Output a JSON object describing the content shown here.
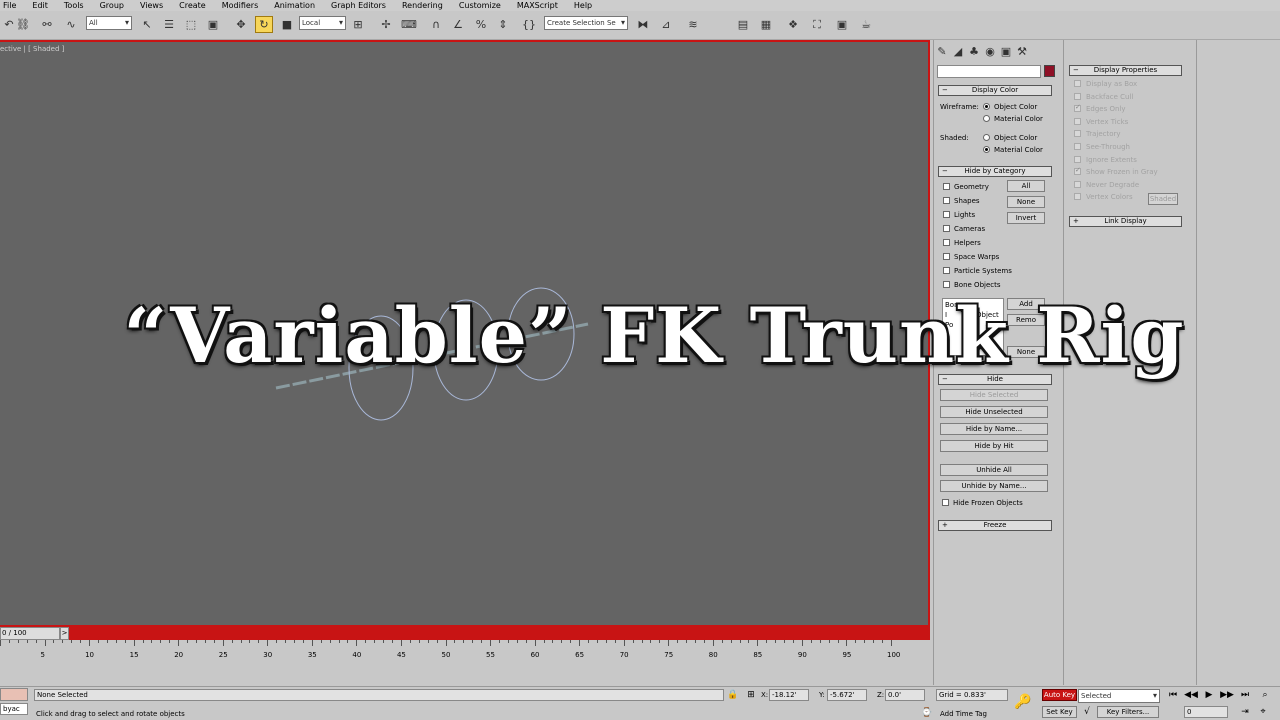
{
  "menu": {
    "items": [
      "File",
      "Edit",
      "Tools",
      "Group",
      "Views",
      "Create",
      "Modifiers",
      "Animation",
      "Graph Editors",
      "Rendering",
      "Customize",
      "MAXScript",
      "Help"
    ]
  },
  "toolbar": {
    "selection_filter": "All",
    "ref_coord": "Local",
    "named_selection_placeholder": "Create Selection Se"
  },
  "viewport": {
    "label": "ective | [ Shaded ]",
    "border_color": "#c81414"
  },
  "overlay": {
    "title": "“Variable” FK Trunk Rig"
  },
  "command_panel": {
    "display_color": {
      "title": "Display Color",
      "wireframe_label": "Wireframe:",
      "shaded_label": "Shaded:",
      "object_color": "Object Color",
      "material_color": "Material Color",
      "wireframe_selected": "Object Color",
      "shaded_selected": "Material Color"
    },
    "object_color": "#8e1026",
    "hide_by_category": {
      "title": "Hide by Category",
      "items": [
        "Geometry",
        "Shapes",
        "Lights",
        "Cameras",
        "Helpers",
        "Space Warps",
        "Particle Systems",
        "Bone Objects"
      ],
      "buttons": [
        "All",
        "None",
        "Invert"
      ]
    },
    "list_box": {
      "col1": [
        "Bone",
        "I",
        "Po"
      ],
      "object": "Object",
      "add": "Add",
      "remove": "Remo",
      "none": "None"
    },
    "hide": {
      "title": "Hide",
      "hide_selected": "Hide Selected",
      "hide_unselected": "Hide Unselected",
      "hide_by_name": "Hide by Name...",
      "hide_by_hit": "Hide by Hit",
      "unhide_all": "Unhide All",
      "unhide_by_name": "Unhide by Name...",
      "hide_frozen": "Hide Frozen Objects"
    },
    "freeze": {
      "title": "Freeze"
    }
  },
  "display_properties": {
    "title": "Display Properties",
    "items": [
      "Display as Box",
      "Backface Cull",
      "Edges Only",
      "Vertex Ticks",
      "Trajectory",
      "See-Through",
      "Ignore Extents",
      "Show Frozen in Gray",
      "Never Degrade",
      "Vertex Colors"
    ],
    "shaded_button": "Shaded",
    "link_display": "Link Display"
  },
  "timeline": {
    "frame": "0 / 100",
    "arrow": ">",
    "ticks": [
      "5",
      "10",
      "15",
      "20",
      "25",
      "30",
      "35",
      "40",
      "45",
      "50",
      "55",
      "60",
      "65",
      "70",
      "75",
      "80",
      "85",
      "90",
      "95",
      "100"
    ]
  },
  "status": {
    "script_field": "byac",
    "selection": "None Selected",
    "prompt": "Click and drag to select and rotate objects",
    "x_label": "X:",
    "x": "-18.12'",
    "y_label": "Y:",
    "y": "-5.672'",
    "z_label": "Z:",
    "z": "0.0'",
    "grid": "Grid = 0.833'",
    "add_time_tag": "Add Time Tag",
    "auto_key": "Auto Key",
    "set_key": "Set Key",
    "key_mode": "Selected",
    "key_filters": "Key Filters...",
    "current_frame": "0"
  }
}
